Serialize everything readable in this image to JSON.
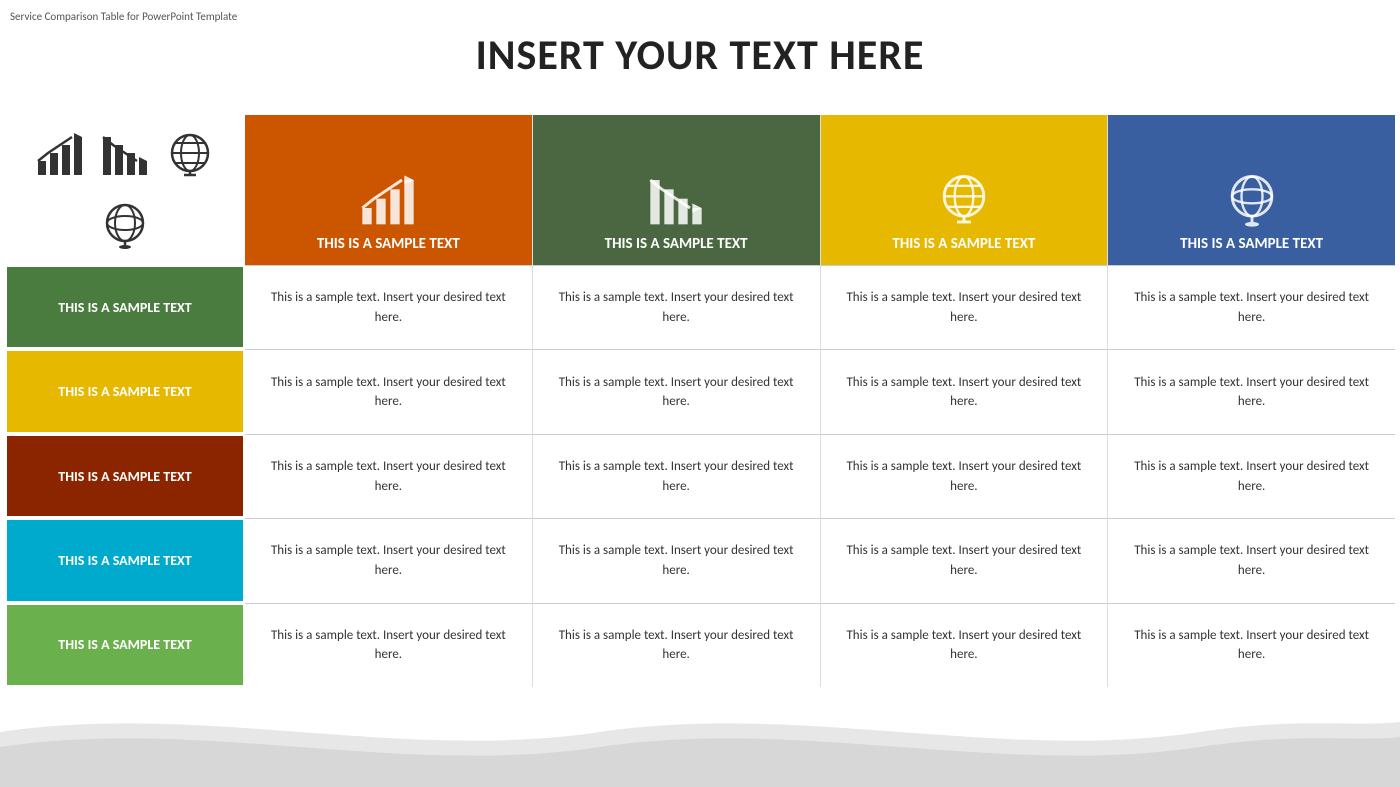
{
  "branding": "Service Comparison Table for PowerPoint Template",
  "title": "INSERT YOUR TEXT HERE",
  "col_headers": [
    {
      "id": "col1",
      "label": "THIS IS A SAMPLE TEXT",
      "color": "orange"
    },
    {
      "id": "col2",
      "label": "THIS IS A SAMPLE TEXT",
      "color": "dark-green"
    },
    {
      "id": "col3",
      "label": "THIS IS A SAMPLE TEXT",
      "color": "gold"
    },
    {
      "id": "col4",
      "label": "THIS IS A SAMPLE TEXT",
      "color": "blue"
    }
  ],
  "row_labels": [
    {
      "label": "THIS IS A SAMPLE TEXT",
      "color": "green"
    },
    {
      "label": "THIS IS A SAMPLE TEXT",
      "color": "yellow"
    },
    {
      "label": "THIS IS A SAMPLE TEXT",
      "color": "brown"
    },
    {
      "label": "THIS IS A SAMPLE TEXT",
      "color": "cyan"
    },
    {
      "label": "THIS IS A SAMPLE TEXT",
      "color": "lime"
    }
  ],
  "cell_text": "This is a sample text. Insert your desired text here.",
  "icons": {
    "bar_chart_up": "bar-chart-up-icon",
    "bar_chart_down": "bar-chart-down-icon",
    "globe_flat": "globe-flat-icon",
    "globe_3d": "globe-3d-icon"
  }
}
